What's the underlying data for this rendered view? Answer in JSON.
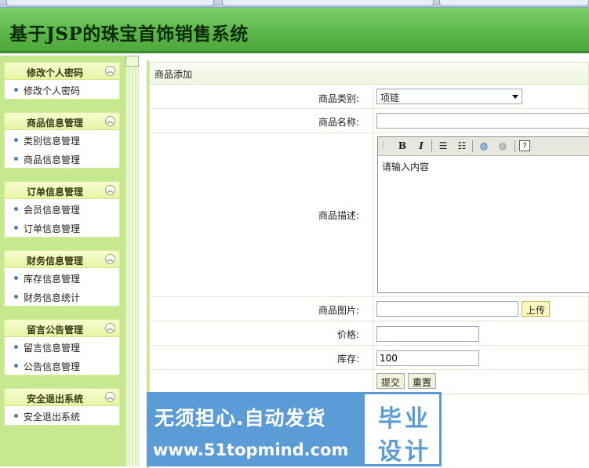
{
  "header": {
    "title": "基于JSP的珠宝首饰销售系统"
  },
  "sidebar": {
    "groups": [
      {
        "title": "修改个人密码",
        "items": [
          "修改个人密码"
        ]
      },
      {
        "title": "商品信息管理",
        "items": [
          "类别信息管理",
          "商品信息管理"
        ]
      },
      {
        "title": "订单信息管理",
        "items": [
          "会员信息管理",
          "订单信息管理"
        ]
      },
      {
        "title": "财务信息管理",
        "items": [
          "库存信息管理",
          "财务信息统计"
        ]
      },
      {
        "title": "留言公告管理",
        "items": [
          "留言信息管理",
          "公告信息管理"
        ]
      },
      {
        "title": "安全退出系统",
        "items": [
          "安全退出系统"
        ]
      }
    ]
  },
  "form": {
    "title": "商品添加",
    "category_label": "商品类别:",
    "category_value": "项链",
    "name_label": "商品名称:",
    "name_value": "",
    "desc_label": "商品描述:",
    "desc_placeholder": "请输入内容",
    "image_label": "商品图片:",
    "image_value": "",
    "upload_label": "上传",
    "price_label": "价格:",
    "price_value": "",
    "stock_label": "库存:",
    "stock_value": "100",
    "submit_label": "提交",
    "reset_label": "重置"
  },
  "editor_toolbar": [
    "bold-icon",
    "italic-icon",
    "ordered-list-icon",
    "unordered-list-icon",
    "insert-link-icon",
    "remove-link-icon",
    "help-icon"
  ],
  "watermark": {
    "line1": "无须担心.自动发货",
    "line2": "www.51topmind.com",
    "right_line1": "毕业",
    "right_line2": "设计"
  }
}
